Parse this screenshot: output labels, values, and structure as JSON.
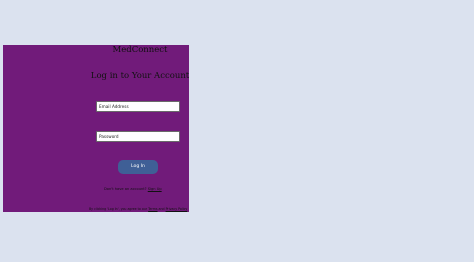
{
  "app": {
    "brand": "MedConnect"
  },
  "login": {
    "heading": "Log in to Your Account",
    "email_placeholder": "Email Address",
    "password_placeholder": "Password",
    "submit_label": "Log In",
    "signup_prompt": "Don't have an account? ",
    "signup_link": "Sign Up",
    "terms_prefix": "By clicking 'Log In', you agree to our ",
    "terms_link": "Terms",
    "terms_and": " and ",
    "privacy_link": "Privacy Policy"
  },
  "colors": {
    "page_background": "#dbe2ef",
    "panel_background": "#711b7a",
    "button_background": "#3f5f96"
  }
}
